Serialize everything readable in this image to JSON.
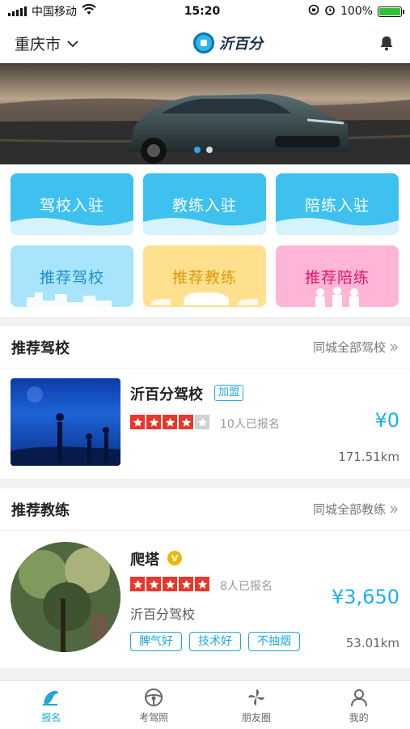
{
  "status_bar": {
    "carrier": "中国移动",
    "time": "15:20",
    "battery": "100%"
  },
  "header": {
    "city": "重庆市",
    "logo_text": "沂百分"
  },
  "banner": {
    "slide_count": 2,
    "active_slide": 1
  },
  "quick_tiles": [
    {
      "label": "驾校入驻",
      "style": "blue"
    },
    {
      "label": "教练入驻",
      "style": "blue"
    },
    {
      "label": "陪练入驻",
      "style": "blue"
    },
    {
      "label": "推荐驾校",
      "style": "light"
    },
    {
      "label": "推荐教练",
      "style": "yellow"
    },
    {
      "label": "推荐陪练",
      "style": "pink"
    }
  ],
  "schools_section": {
    "title": "推荐驾校",
    "more": "同城全部驾校",
    "item": {
      "name": "沂百分驾校",
      "tag": "加盟",
      "rating": 4,
      "enrolled": "10人已报名",
      "price": "¥0",
      "distance": "171.51km"
    }
  },
  "coaches_section": {
    "title": "推荐教练",
    "more": "同城全部教练",
    "item": {
      "name": "爬塔",
      "badge": "V",
      "rating": 5,
      "enrolled": "8人已报名",
      "school": "沂百分驾校",
      "tags": [
        "脾气好",
        "技术好",
        "不抽烟"
      ],
      "price": "¥3,650",
      "distance": "53.01km"
    }
  },
  "tabbar": [
    {
      "label": "报名",
      "icon": "signup-icon",
      "active": true
    },
    {
      "label": "考驾照",
      "icon": "steering-wheel-icon",
      "active": false
    },
    {
      "label": "朋友圈",
      "icon": "pinwheel-icon",
      "active": false
    },
    {
      "label": "我的",
      "icon": "person-icon",
      "active": false
    }
  ],
  "colors": {
    "accent": "#1fa6df",
    "star": "#e8382c",
    "price": "#1fb0e8"
  }
}
